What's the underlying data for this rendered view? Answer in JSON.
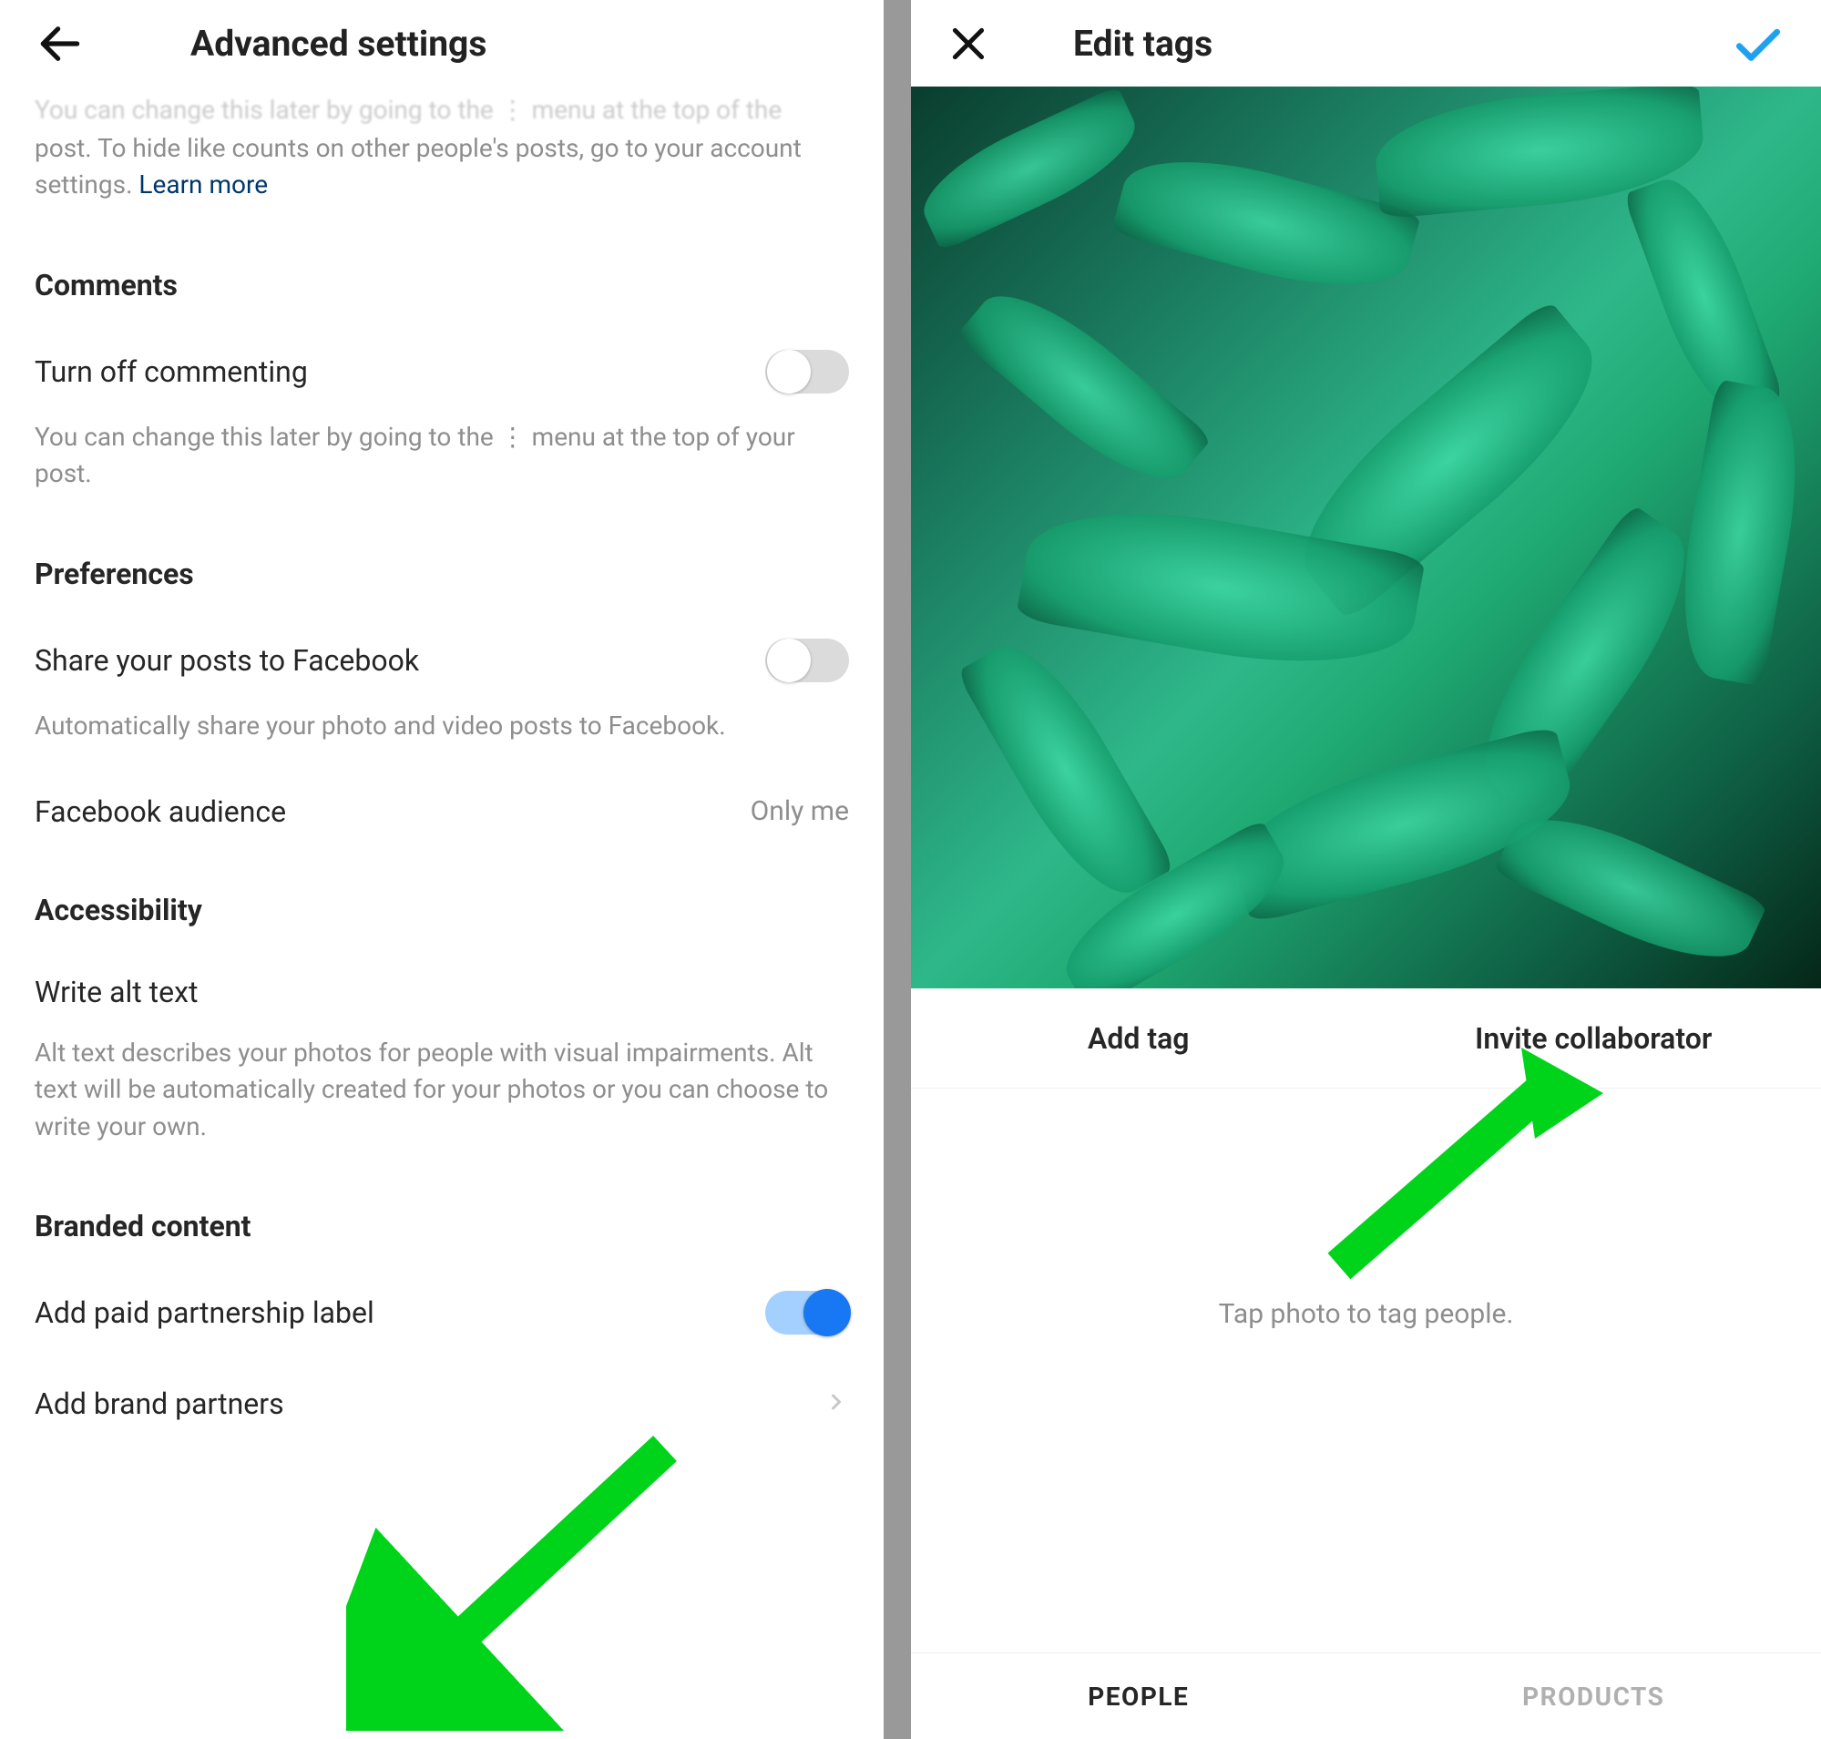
{
  "left": {
    "header_title": "Advanced settings",
    "top_help_cut": "post. To hide like counts on other people's posts, go to your account settings. ",
    "learn_more": "Learn more",
    "sections": {
      "comments": {
        "title": "Comments",
        "toggle_label": "Turn off commenting",
        "help": "You can change this later by going to the  ⋮  menu at the top of your post."
      },
      "preferences": {
        "title": "Preferences",
        "share_fb_label": "Share your posts to Facebook",
        "share_fb_help": "Automatically share your photo and video posts to Facebook.",
        "fb_audience_label": "Facebook audience",
        "fb_audience_value": "Only me"
      },
      "accessibility": {
        "title": "Accessibility",
        "alt_label": "Write alt text",
        "alt_help": "Alt text describes your photos for people with visual impairments. Alt text will be automatically created for your photos or you can choose to write your own."
      },
      "branded": {
        "title": "Branded content",
        "paid_label": "Add paid partnership label",
        "partners_label": "Add brand partners"
      }
    }
  },
  "right": {
    "header_title": "Edit tags",
    "add_tag": "Add tag",
    "invite_collab": "Invite collaborator",
    "tap_hint": "Tap photo to tag people.",
    "tab_people": "PEOPLE",
    "tab_products": "PRODUCTS"
  }
}
